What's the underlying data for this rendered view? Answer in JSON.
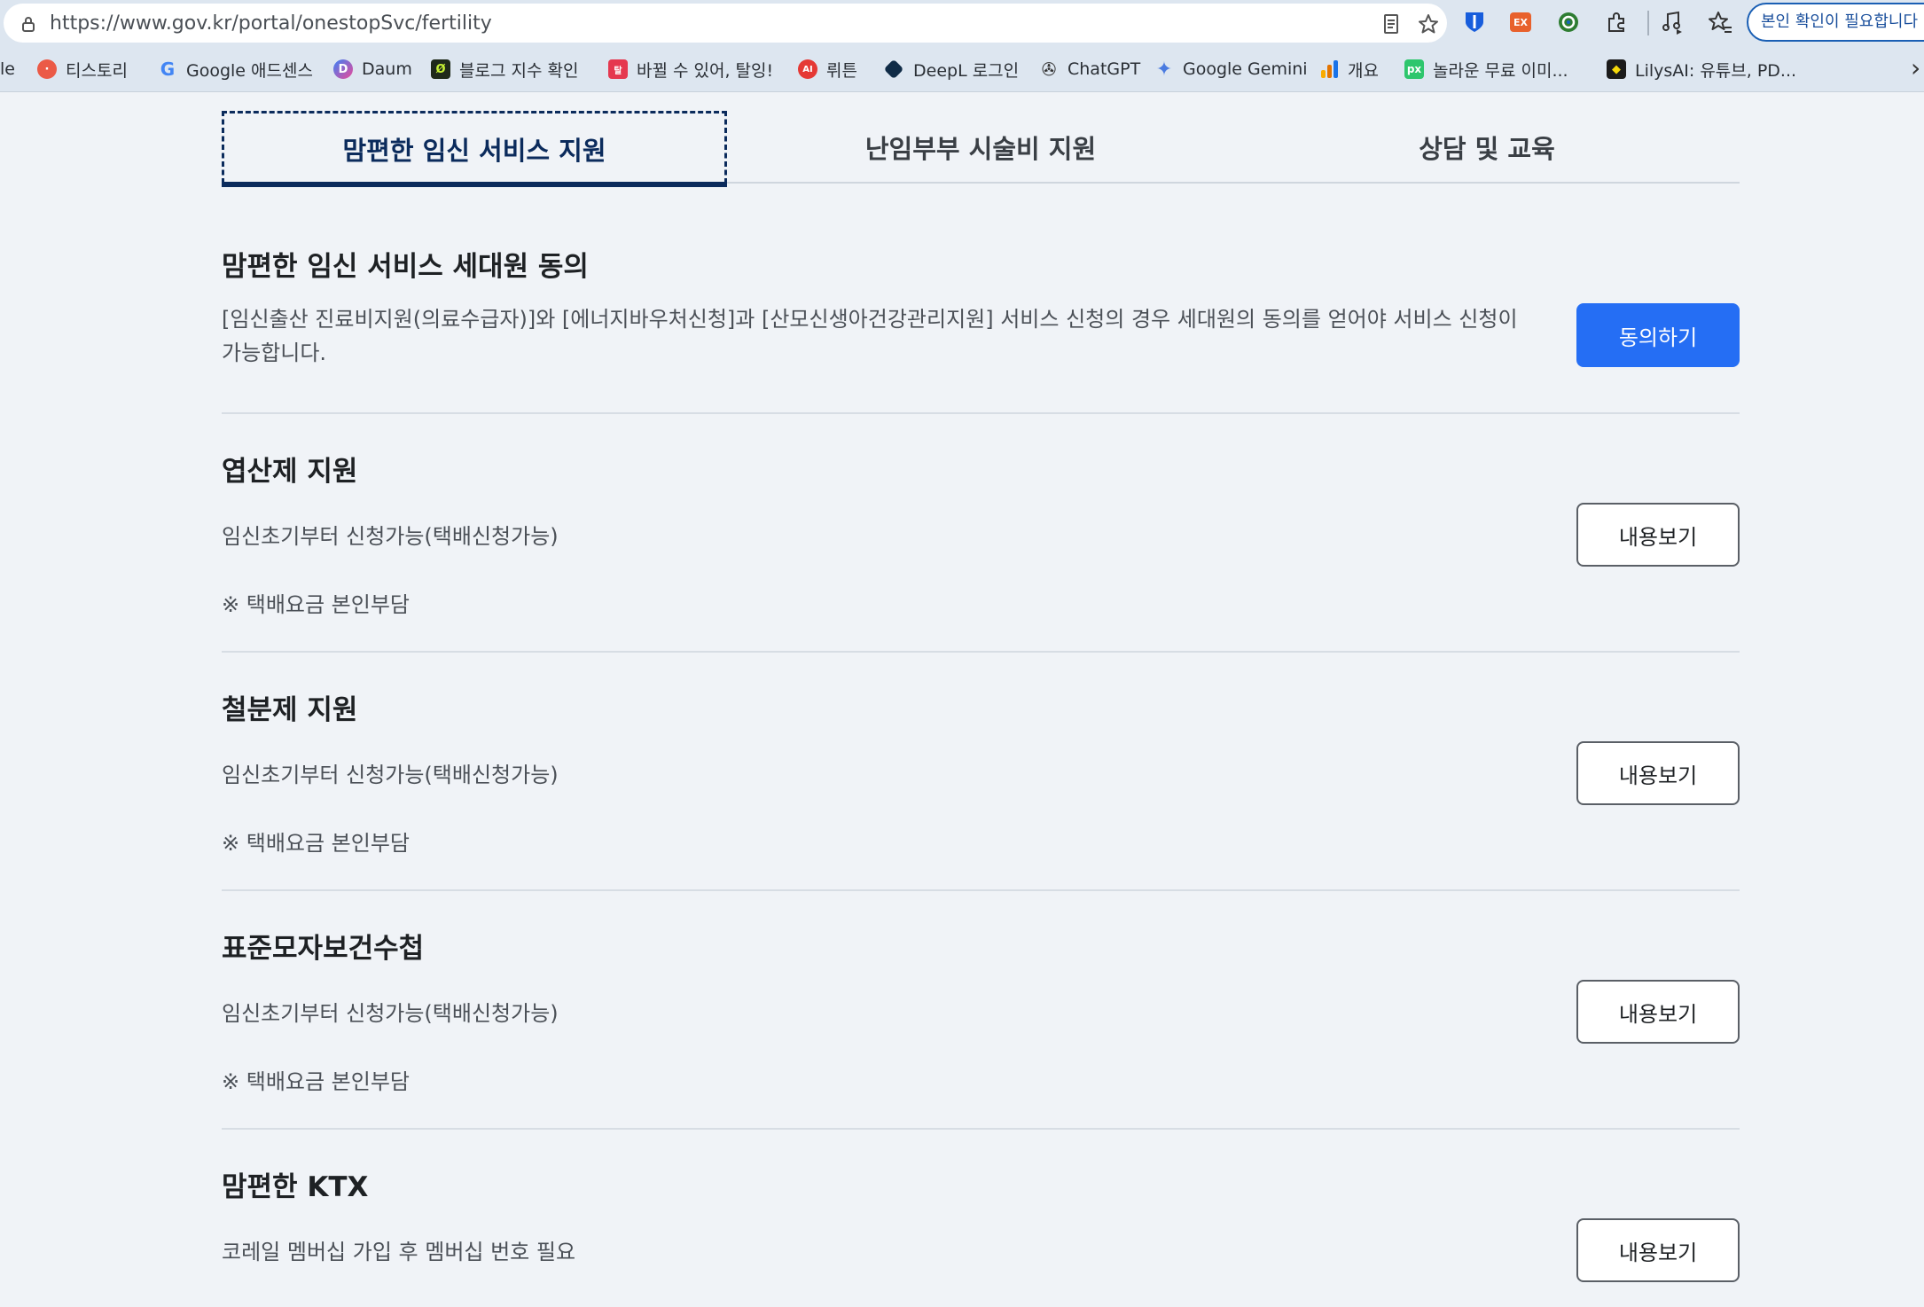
{
  "browser": {
    "url": "https://www.gov.kr/portal/onestopSvc/fertility",
    "auth_button": "본인 확인이 필요합니다",
    "bookmarks": [
      {
        "label": "le",
        "icon": "none"
      },
      {
        "label": "티스토리",
        "icon": "tistory-icon"
      },
      {
        "label": "Google 애드센스",
        "icon": "google-icon"
      },
      {
        "label": "Daum",
        "icon": "daum-icon"
      },
      {
        "label": "블로그 지수 확인",
        "icon": "blog-index-icon"
      },
      {
        "label": "바뀔 수 있어, 탈잉!",
        "icon": "taling-icon"
      },
      {
        "label": "뤼튼",
        "icon": "wrtn-icon"
      },
      {
        "label": "DeepL 로그인",
        "icon": "deepl-icon"
      },
      {
        "label": "ChatGPT",
        "icon": "chatgpt-icon"
      },
      {
        "label": "Google Gemini",
        "icon": "gemini-icon"
      },
      {
        "label": "개요",
        "icon": "analytics-icon"
      },
      {
        "label": "놀라운 무료 이미...",
        "icon": "pixabay-icon"
      },
      {
        "label": "LilysAI: 유튜브, PD...",
        "icon": "lilys-icon"
      }
    ]
  },
  "tabs": [
    {
      "label": "맘편한 임신 서비스 지원",
      "active": true
    },
    {
      "label": "난임부부 시술비 지원",
      "active": false
    },
    {
      "label": "상담 및 교육",
      "active": false
    }
  ],
  "sections": [
    {
      "title": "맘편한 임신 서비스 세대원 동의",
      "description": "[임신출산 진료비지원(의료수급자)]와 [에너지바우처신청]과 [산모신생아건강관리지원] 서비스 신청의 경우 세대원의 동의를 얻어야 서비스 신청이 가능합니다.",
      "button": "동의하기"
    },
    {
      "title": "엽산제 지원",
      "description": "임신초기부터 신청가능(택배신청가능)",
      "note": "※ 택배요금 본인부담",
      "button": "내용보기"
    },
    {
      "title": "철분제 지원",
      "description": "임신초기부터 신청가능(택배신청가능)",
      "note": "※ 택배요금 본인부담",
      "button": "내용보기"
    },
    {
      "title": "표준모자보건수첩",
      "description": "임신초기부터 신청가능(택배신청가능)",
      "note": "※ 택배요금 본인부담",
      "button": "내용보기"
    },
    {
      "title": "맘편한 KTX",
      "description": "코레일 멤버십 가입 후 멤버십 번호 필요",
      "button": "내용보기"
    }
  ],
  "colors": {
    "primary": "#256ef4",
    "active_tab": "#0b2b5c",
    "page_bg": "#f0f3f7"
  }
}
